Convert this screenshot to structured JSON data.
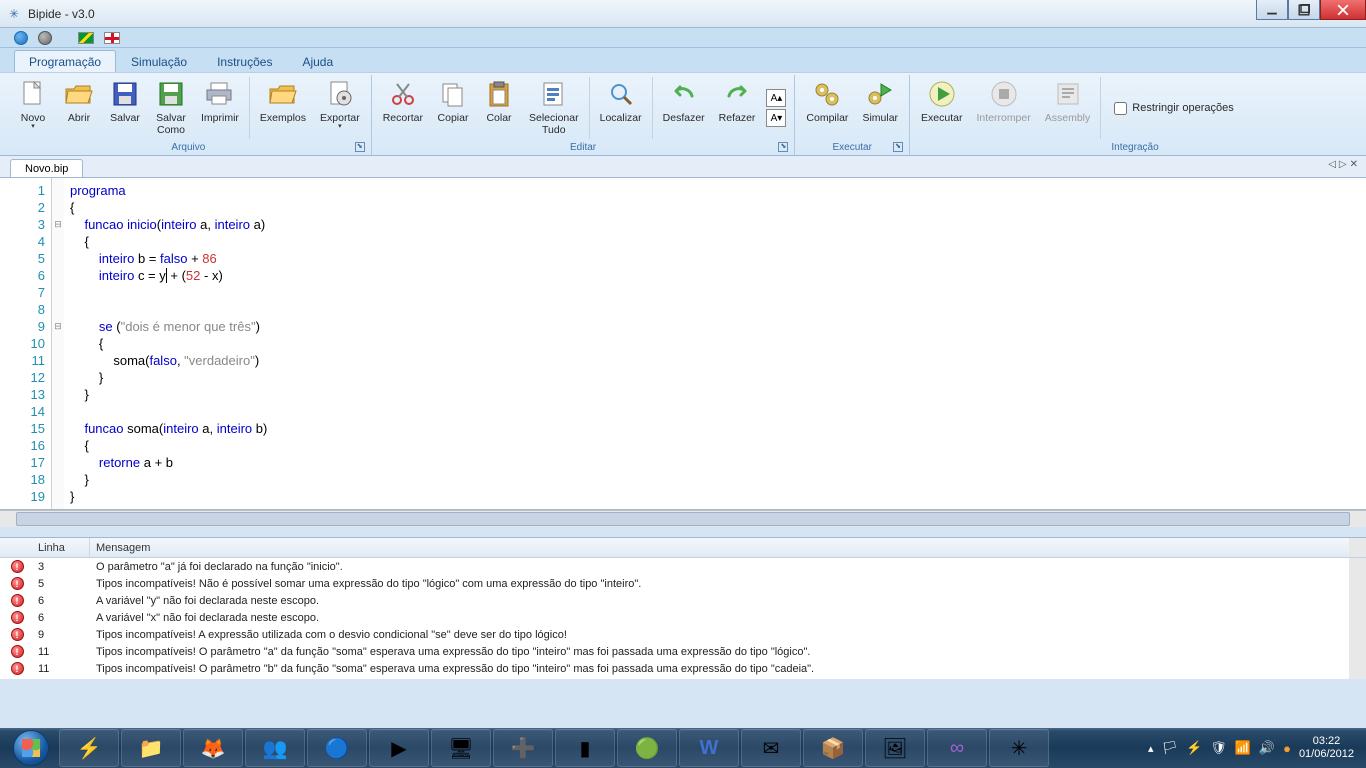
{
  "window": {
    "title": "Bipide - v3.0"
  },
  "tabs": [
    "Programação",
    "Simulação",
    "Instruções",
    "Ajuda"
  ],
  "active_tab": 0,
  "ribbon": {
    "arquivo": {
      "label": "Arquivo",
      "novo": "Novo",
      "abrir": "Abrir",
      "salvar": "Salvar",
      "salvar_como": "Salvar\nComo",
      "imprimir": "Imprimir",
      "exemplos": "Exemplos",
      "exportar": "Exportar"
    },
    "editar": {
      "label": "Editar",
      "recortar": "Recortar",
      "copiar": "Copiar",
      "colar": "Colar",
      "selecionar": "Selecionar\nTudo",
      "localizar": "Localizar",
      "desfazer": "Desfazer",
      "refazer": "Refazer"
    },
    "executar": {
      "label": "Executar",
      "compilar": "Compilar",
      "simular": "Simular"
    },
    "integracao": {
      "label": "Integração",
      "executar": "Executar",
      "interromper": "Interromper",
      "assembly": "Assembly",
      "restringir": "Restringir operações"
    }
  },
  "file_tab": "Novo.bip",
  "code": {
    "lines": [
      {
        "n": 1,
        "tokens": [
          [
            "kw",
            "programa"
          ]
        ]
      },
      {
        "n": 2,
        "tokens": [
          [
            "",
            "{"
          ]
        ]
      },
      {
        "n": 3,
        "fold": "-",
        "tokens": [
          [
            "",
            "    "
          ],
          [
            "kw",
            "funcao"
          ],
          [
            "",
            " "
          ],
          [
            "kw",
            "inicio"
          ],
          [
            "",
            "("
          ],
          [
            "kw",
            "inteiro"
          ],
          [
            "",
            " a, "
          ],
          [
            "kw",
            "inteiro"
          ],
          [
            "",
            " a)"
          ]
        ]
      },
      {
        "n": 4,
        "tokens": [
          [
            "",
            "    {"
          ]
        ]
      },
      {
        "n": 5,
        "tokens": [
          [
            "",
            "        "
          ],
          [
            "kw",
            "inteiro"
          ],
          [
            "",
            " b = "
          ],
          [
            "kw",
            "falso"
          ],
          [
            "",
            " + "
          ],
          [
            "num",
            "86"
          ]
        ]
      },
      {
        "n": 6,
        "tokens": [
          [
            "",
            "        "
          ],
          [
            "kw",
            "inteiro"
          ],
          [
            "",
            " c = y"
          ],
          [
            "cur",
            ""
          ],
          [
            "",
            " + ("
          ],
          [
            "num",
            "52"
          ],
          [
            "",
            " - x)"
          ]
        ]
      },
      {
        "n": 7,
        "tokens": [
          [
            "",
            ""
          ]
        ]
      },
      {
        "n": 8,
        "tokens": [
          [
            "",
            ""
          ]
        ]
      },
      {
        "n": 9,
        "fold": "-",
        "tokens": [
          [
            "",
            "        "
          ],
          [
            "kw",
            "se"
          ],
          [
            "",
            " ("
          ],
          [
            "str",
            "\"dois é menor que três\""
          ],
          [
            "",
            ")"
          ]
        ]
      },
      {
        "n": 10,
        "tokens": [
          [
            "",
            "        {"
          ]
        ]
      },
      {
        "n": 11,
        "tokens": [
          [
            "",
            "            soma("
          ],
          [
            "kw",
            "falso"
          ],
          [
            "",
            ", "
          ],
          [
            "str",
            "\"verdadeiro\""
          ],
          [
            "",
            ")"
          ]
        ]
      },
      {
        "n": 12,
        "tokens": [
          [
            "",
            "        }"
          ]
        ]
      },
      {
        "n": 13,
        "tokens": [
          [
            "",
            "    }"
          ]
        ]
      },
      {
        "n": 14,
        "tokens": [
          [
            "",
            ""
          ]
        ]
      },
      {
        "n": 15,
        "tokens": [
          [
            "",
            "    "
          ],
          [
            "kw",
            "funcao"
          ],
          [
            "",
            " soma("
          ],
          [
            "kw",
            "inteiro"
          ],
          [
            "",
            " a, "
          ],
          [
            "kw",
            "inteiro"
          ],
          [
            "",
            " b)"
          ]
        ]
      },
      {
        "n": 16,
        "tokens": [
          [
            "",
            "    {"
          ]
        ]
      },
      {
        "n": 17,
        "tokens": [
          [
            "",
            "        "
          ],
          [
            "kw",
            "retorne"
          ],
          [
            "",
            " a + b"
          ]
        ]
      },
      {
        "n": 18,
        "tokens": [
          [
            "",
            "    }"
          ]
        ]
      },
      {
        "n": 19,
        "tokens": [
          [
            "",
            "}"
          ]
        ]
      }
    ]
  },
  "errors": {
    "col_linha": "Linha",
    "col_mensagem": "Mensagem",
    "rows": [
      {
        "line": 3,
        "msg": "O parâmetro \"a\" já foi declarado na função \"inicio\"."
      },
      {
        "line": 5,
        "msg": "Tipos incompatíveis! Não é possível somar uma expressão do tipo \"lógico\" com uma expressão do tipo \"inteiro\"."
      },
      {
        "line": 6,
        "msg": "A variável \"y\" não foi declarada neste escopo."
      },
      {
        "line": 6,
        "msg": "A variável \"x\" não foi declarada neste escopo."
      },
      {
        "line": 9,
        "msg": "Tipos incompatíveis! A expressão utilizada com o desvio condicional \"se\" deve ser do tipo lógico!"
      },
      {
        "line": 11,
        "msg": "Tipos incompatíveis! O parâmetro \"a\" da função \"soma\" esperava uma expressão do tipo \"inteiro\" mas foi passada uma expressão do tipo \"lógico\"."
      },
      {
        "line": 11,
        "msg": "Tipos incompatíveis! O parâmetro \"b\" da função \"soma\" esperava uma expressão do tipo \"inteiro\" mas foi passada uma expressão do tipo \"cadeia\"."
      }
    ]
  },
  "taskbar": {
    "time": "03:22",
    "date": "01/06/2012"
  }
}
